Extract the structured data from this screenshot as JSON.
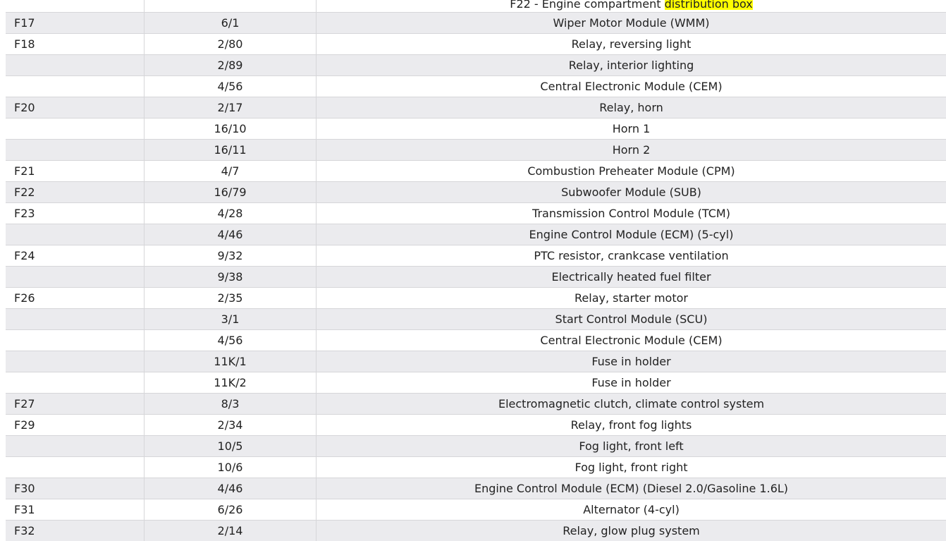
{
  "header_row": {
    "fuse": "",
    "connector": "",
    "component_prefix": "F22 - Engine compartment ",
    "component_highlight": "distribution box",
    "highlight_color": "#ffff00"
  },
  "rows": [
    {
      "fuse": "F17",
      "connector": "6/1",
      "component": "Wiper Motor Module (WMM)"
    },
    {
      "fuse": "F18",
      "connector": "2/80",
      "component": "Relay, reversing light"
    },
    {
      "fuse": "",
      "connector": "2/89",
      "component": "Relay, interior lighting"
    },
    {
      "fuse": "",
      "connector": "4/56",
      "component": "Central Electronic Module (CEM)"
    },
    {
      "fuse": "F20",
      "connector": "2/17",
      "component": "Relay, horn"
    },
    {
      "fuse": "",
      "connector": "16/10",
      "component": "Horn 1"
    },
    {
      "fuse": "",
      "connector": "16/11",
      "component": "Horn 2"
    },
    {
      "fuse": "F21",
      "connector": "4/7",
      "component": "Combustion Preheater Module (CPM)"
    },
    {
      "fuse": "F22",
      "connector": "16/79",
      "component": "Subwoofer Module (SUB)"
    },
    {
      "fuse": "F23",
      "connector": "4/28",
      "component": "Transmission Control Module (TCM)"
    },
    {
      "fuse": "",
      "connector": "4/46",
      "component": "Engine Control Module (ECM) (5-cyl)"
    },
    {
      "fuse": "F24",
      "connector": "9/32",
      "component": "PTC resistor, crankcase ventilation"
    },
    {
      "fuse": "",
      "connector": "9/38",
      "component": "Electrically heated fuel filter"
    },
    {
      "fuse": "F26",
      "connector": "2/35",
      "component": "Relay, starter motor"
    },
    {
      "fuse": "",
      "connector": "3/1",
      "component": "Start Control Module (SCU)"
    },
    {
      "fuse": "",
      "connector": "4/56",
      "component": "Central Electronic Module (CEM)"
    },
    {
      "fuse": "",
      "connector": "11K/1",
      "component": "Fuse in holder"
    },
    {
      "fuse": "",
      "connector": "11K/2",
      "component": "Fuse in holder"
    },
    {
      "fuse": "F27",
      "connector": "8/3",
      "component": "Electromagnetic clutch, climate control system"
    },
    {
      "fuse": "F29",
      "connector": "2/34",
      "component": "Relay, front fog lights"
    },
    {
      "fuse": "",
      "connector": "10/5",
      "component": "Fog light, front left"
    },
    {
      "fuse": "",
      "connector": "10/6",
      "component": "Fog light, front right"
    },
    {
      "fuse": "F30",
      "connector": "4/46",
      "component": "Engine Control Module (ECM) (Diesel 2.0/Gasoline 1.6L)"
    },
    {
      "fuse": "F31",
      "connector": "6/26",
      "component": "Alternator (4-cyl)"
    },
    {
      "fuse": "F32",
      "connector": "2/14",
      "component": "Relay, glow plug system"
    }
  ]
}
